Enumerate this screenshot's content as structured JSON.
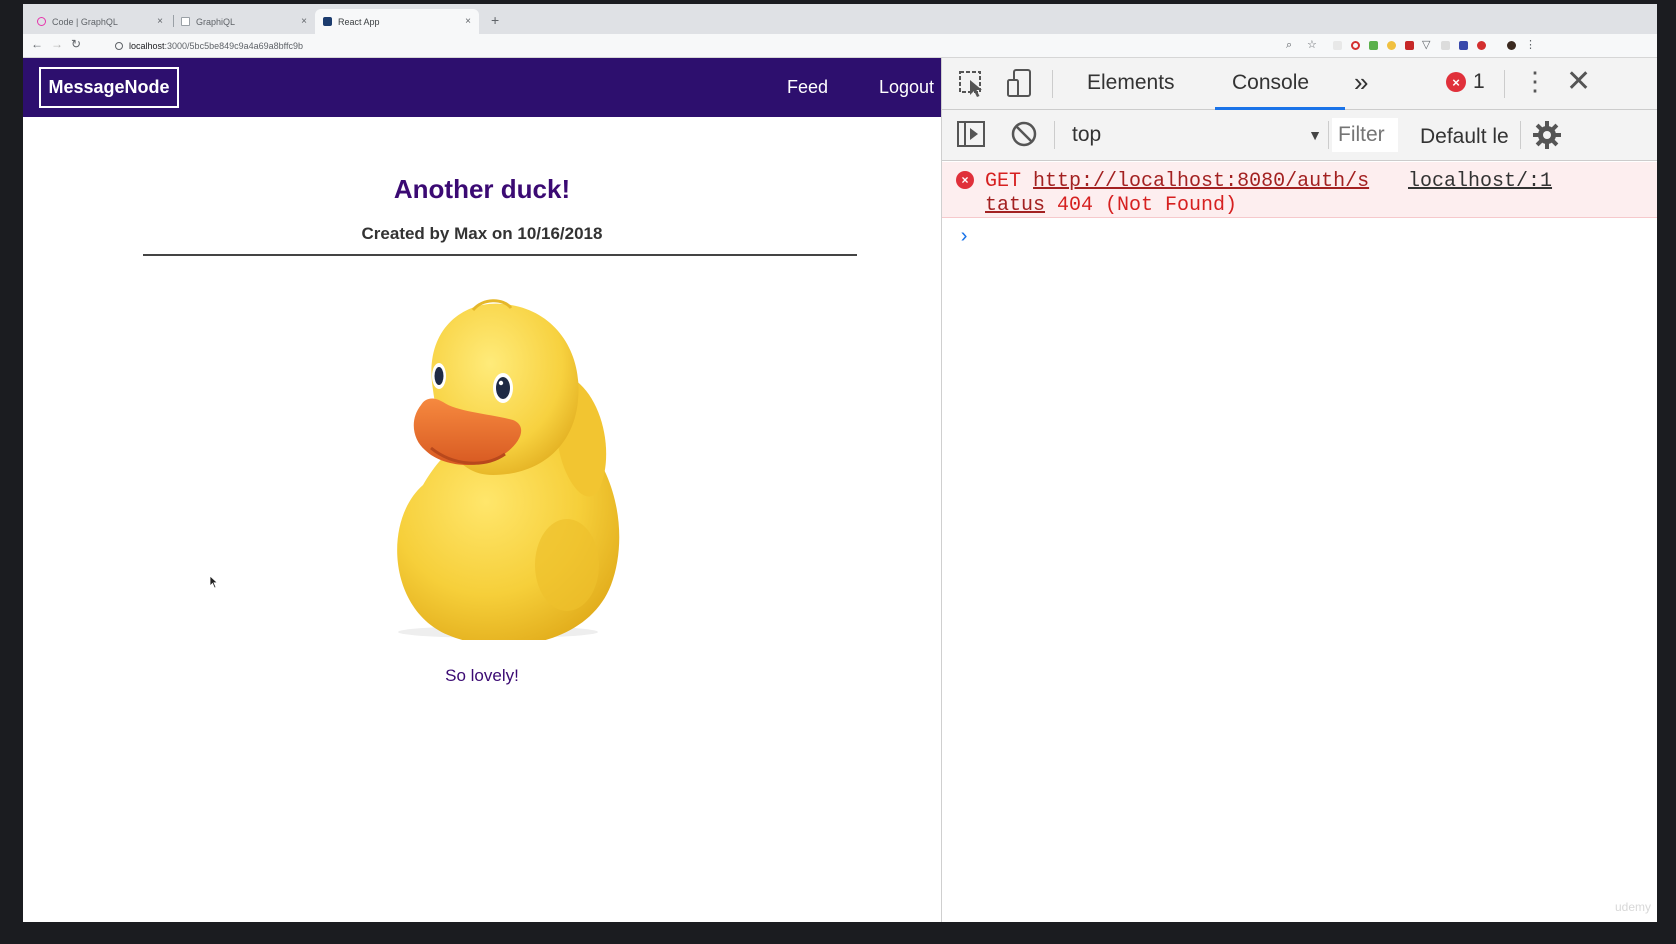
{
  "browser": {
    "tabs": [
      {
        "title": "Code | GraphQL",
        "favicon_color": "#e535ab"
      },
      {
        "title": "GraphiQL",
        "favicon_color": "#9aa0a6"
      },
      {
        "title": "React App",
        "favicon_color": "#1c3c6e"
      }
    ],
    "new_tab": "+",
    "url_host": "localhost",
    "url_path": ":3000/5bc5be849c9a4a69a8bffc9b"
  },
  "app": {
    "logo": "MessageNode",
    "nav": {
      "feed": "Feed",
      "logout": "Logout"
    },
    "post": {
      "title": "Another duck!",
      "meta": "Created by Max on 10/16/2018",
      "content": "So lovely!"
    }
  },
  "devtools": {
    "tabs": {
      "elements": "Elements",
      "console": "Console",
      "more": "»"
    },
    "error_count": "1",
    "context": "top",
    "filter_placeholder": "Filter",
    "levels": "Default le",
    "error": {
      "method": "GET",
      "url": "http://localhost:8080/auth/s",
      "url_cont": "tatus",
      "status": "404 (Not Found)",
      "source": "localhost/:1"
    },
    "prompt": "›"
  },
  "colors": {
    "app_header": "#2d0f6e",
    "accent_text": "#3b0a73",
    "console_error_bg": "#fdeeef",
    "console_error_text": "#d62020",
    "devtools_active_tab": "#1a73e8"
  }
}
